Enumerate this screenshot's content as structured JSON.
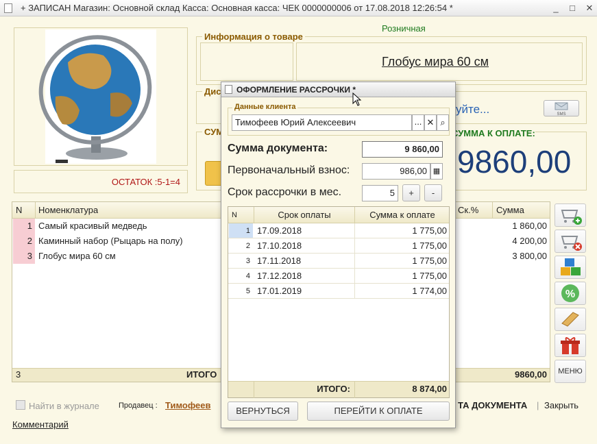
{
  "window": {
    "title": "+ ЗАПИСАН Магазин: Основной склад Касса: Основная касса: ЧЕК 0000000006 от 17.08.2018 12:26:54 *",
    "min": "_",
    "max": "□",
    "close": "✕"
  },
  "header": {
    "price_type": "Розничная",
    "product_info_legend": "Информация о товаре",
    "product_name": "Глобус мира 60 см",
    "discount_legend_partial": "Дис",
    "sum_legend_partial": "СУМ",
    "hint_partial": "уйте...",
    "sms_label": "SMS",
    "pay_label": "СУММА К ОПЛАТЕ:",
    "pay_amount": "9860,00",
    "stock_text": "ОСТАТОК :5-1=4"
  },
  "grid": {
    "columns": {
      "n": "N",
      "name": "Номенклатура",
      "disc": "Ск.%",
      "sum": "Сумма"
    },
    "rows": [
      {
        "n": "1",
        "name": "Самый красивый медведь",
        "sum": "1 860,00"
      },
      {
        "n": "2",
        "name": "Каминный набор (Рыцарь на полу)",
        "sum": "4 200,00"
      },
      {
        "n": "3",
        "name": "Глобус мира 60 см",
        "sum": "3 800,00"
      }
    ],
    "footer": {
      "count": "3",
      "total_label": "ИТОГО",
      "total_sum": "9860,00"
    }
  },
  "side_buttons": {
    "menu": "МЕНЮ"
  },
  "bottom": {
    "find_journal": "Найти в журнале",
    "seller_label": "Продавец :",
    "seller_name": "Тимофеев",
    "doc_print_partial": "ТА ДОКУМЕНТА",
    "close": "Закрыть",
    "comment": "Комментарий"
  },
  "modal": {
    "title": "ОФОРМЛЕНИЕ РАССРОЧКИ *",
    "client_legend": "Данные клиента",
    "client_name": "Тимофеев Юрий Алексеевич",
    "doc_sum_label": "Сумма документа:",
    "doc_sum": "9 860,00",
    "down_payment_label": "Первоначальный взнос:",
    "down_payment": "986,00",
    "term_label": "Срок рассрочки в мес.",
    "term": "5",
    "plus": "+",
    "minus": "-",
    "table": {
      "columns": {
        "n": "N",
        "date": "Срок оплаты",
        "amount": "Сумма к  оплате"
      },
      "rows": [
        {
          "n": "1",
          "date": "17.09.2018",
          "amount": "1 775,00"
        },
        {
          "n": "2",
          "date": "17.10.2018",
          "amount": "1 775,00"
        },
        {
          "n": "3",
          "date": "17.11.2018",
          "amount": "1 775,00"
        },
        {
          "n": "4",
          "date": "17.12.2018",
          "amount": "1 775,00"
        },
        {
          "n": "5",
          "date": "17.01.2019",
          "amount": "1 774,00"
        }
      ],
      "total_label": "ИТОГО:",
      "total": "8 874,00"
    },
    "back_button": "ВЕРНУТЬСЯ",
    "pay_button": "ПЕРЕЙТИ К ОПЛАТЕ"
  }
}
